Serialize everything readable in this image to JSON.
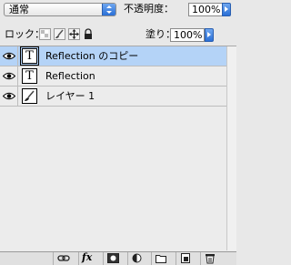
{
  "options": {
    "blend_mode": "通常",
    "opacity_label": "不透明度：",
    "opacity_value": "100%",
    "lock_label": "ロック：",
    "fill_label": "塗り：",
    "fill_value": "100%"
  },
  "layers": [
    {
      "name": "Reflection のコピー",
      "thumb": "T",
      "selected": true
    },
    {
      "name": "Reflection",
      "thumb": "T",
      "selected": false
    },
    {
      "name": "レイヤー 1",
      "thumb": "brush",
      "selected": false
    }
  ],
  "bottom_bar": {
    "fx_label": "fx"
  },
  "colors": {
    "selection": "#b4d3f7",
    "accent": "#2a6fd6"
  }
}
